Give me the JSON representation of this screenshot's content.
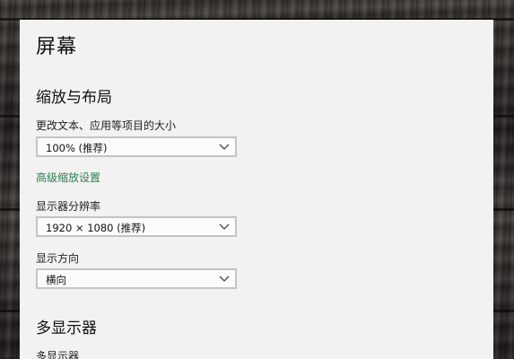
{
  "page": {
    "title": "屏幕"
  },
  "scale_layout": {
    "heading": "缩放与布局",
    "text_size_label": "更改文本、应用等项目的大小",
    "text_size_value": "100% (推荐)",
    "advanced_link": "高级缩放设置",
    "resolution_label": "显示器分辨率",
    "resolution_value": "1920 × 1080 (推荐)",
    "orientation_label": "显示方向",
    "orientation_value": "横向"
  },
  "multi_display": {
    "heading": "多显示器",
    "label": "多显示器"
  },
  "colors": {
    "link": "#2e7d4f",
    "panel": "#f2f2f2",
    "dropdown_border": "#c4c4c4"
  },
  "icons": {
    "dropdown": "chevron-down-icon"
  }
}
